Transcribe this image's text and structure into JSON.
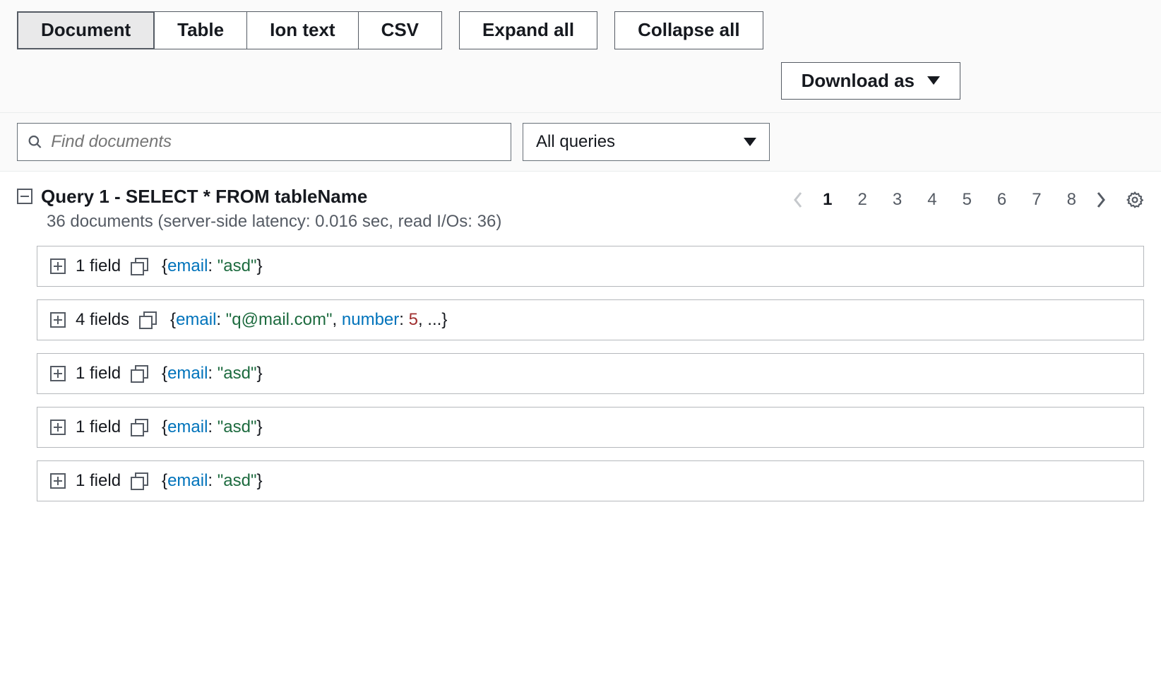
{
  "tabs": {
    "document": "Document",
    "table": "Table",
    "iontext": "Ion text",
    "csv": "CSV",
    "expand_all": "Expand all",
    "collapse_all": "Collapse all"
  },
  "download_label": "Download as",
  "search": {
    "placeholder": "Find documents"
  },
  "filter_select": {
    "value": "All queries"
  },
  "query": {
    "title": "Query 1 - SELECT * FROM tableName",
    "subtitle": "36 documents (server-side latency: 0.016 sec, read I/Os: 36)"
  },
  "pagination": {
    "pages": [
      "1",
      "2",
      "3",
      "4",
      "5",
      "6",
      "7",
      "8"
    ],
    "current": "1"
  },
  "documents": [
    {
      "field_label": "1 field",
      "preview": [
        {
          "t": "brace",
          "v": "{"
        },
        {
          "t": "key",
          "v": "email"
        },
        {
          "t": "plain",
          "v": ": "
        },
        {
          "t": "str",
          "v": "\"asd\""
        },
        {
          "t": "brace",
          "v": "}"
        }
      ]
    },
    {
      "field_label": "4 fields",
      "preview": [
        {
          "t": "brace",
          "v": "{"
        },
        {
          "t": "key",
          "v": "email"
        },
        {
          "t": "plain",
          "v": ": "
        },
        {
          "t": "str",
          "v": "\"q@mail.com\""
        },
        {
          "t": "plain",
          "v": ", "
        },
        {
          "t": "key",
          "v": "number"
        },
        {
          "t": "plain",
          "v": ": "
        },
        {
          "t": "num",
          "v": "5"
        },
        {
          "t": "plain",
          "v": ", "
        },
        {
          "t": "dots",
          "v": "..."
        },
        {
          "t": "brace",
          "v": "}"
        }
      ]
    },
    {
      "field_label": "1 field",
      "preview": [
        {
          "t": "brace",
          "v": "{"
        },
        {
          "t": "key",
          "v": "email"
        },
        {
          "t": "plain",
          "v": ": "
        },
        {
          "t": "str",
          "v": "\"asd\""
        },
        {
          "t": "brace",
          "v": "}"
        }
      ]
    },
    {
      "field_label": "1 field",
      "preview": [
        {
          "t": "brace",
          "v": "{"
        },
        {
          "t": "key",
          "v": "email"
        },
        {
          "t": "plain",
          "v": ": "
        },
        {
          "t": "str",
          "v": "\"asd\""
        },
        {
          "t": "brace",
          "v": "}"
        }
      ]
    },
    {
      "field_label": "1 field",
      "preview": [
        {
          "t": "brace",
          "v": "{"
        },
        {
          "t": "key",
          "v": "email"
        },
        {
          "t": "plain",
          "v": ": "
        },
        {
          "t": "str",
          "v": "\"asd\""
        },
        {
          "t": "brace",
          "v": "}"
        }
      ]
    }
  ]
}
